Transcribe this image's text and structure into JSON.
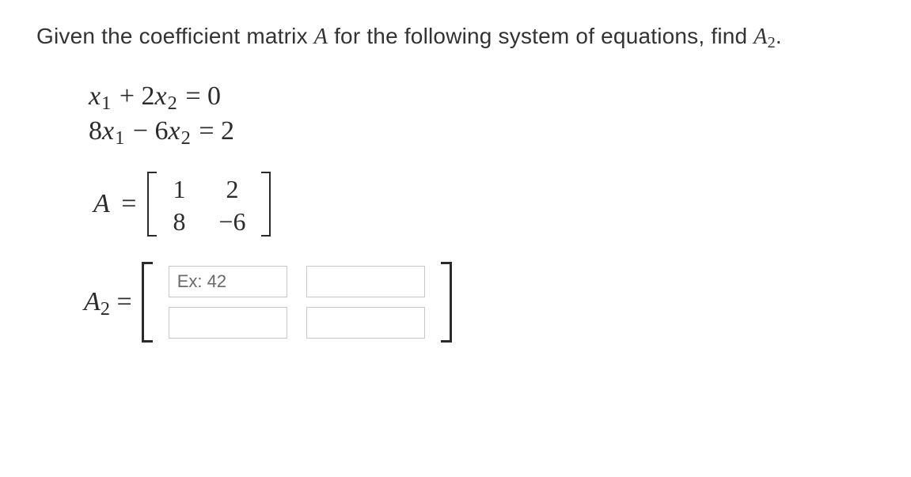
{
  "prompt": {
    "part1": "Given the coefficient matrix ",
    "A": "A",
    "part2": " for the following system of equations, find ",
    "A2": "A",
    "A2_sub": "2",
    "part3": "."
  },
  "system": {
    "eq1": {
      "c1": "",
      "x1": "x",
      "s1": "1",
      "op": " + ",
      "c2": "2",
      "x2": "x",
      "s2": "2",
      "eq": " = ",
      "rhs": "0"
    },
    "eq2": {
      "c1": "8",
      "x1": "x",
      "s1": "1",
      "op": " − ",
      "c2": "6",
      "x2": "x",
      "s2": "2",
      "eq": " = ",
      "rhs": "2"
    }
  },
  "matrixA": {
    "label": "A",
    "eq": " = ",
    "cells": {
      "r1c1": "1",
      "r1c2": "2",
      "r2c1": "8",
      "r2c2": "−6"
    }
  },
  "answer": {
    "label": "A",
    "sub": "2",
    "eq": " = ",
    "placeholder": "Ex: 42"
  }
}
